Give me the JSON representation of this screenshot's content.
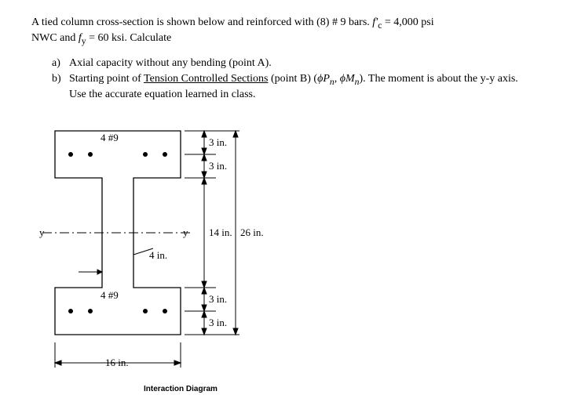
{
  "problem": {
    "line1_prefix": "A tied column cross-section is shown below and reinforced with (8) # 9 bars. ",
    "fc_symbol": "f'",
    "fc_sub": "c",
    "fc_eq": " = 4,000 psi",
    "line2_prefix": "NWC and ",
    "fy_symbol": "f",
    "fy_sub": "y",
    "fy_eq": " = 60 ksi. Calculate"
  },
  "parts": {
    "a": {
      "marker": "a)",
      "text": "Axial capacity without any bending (point A)."
    },
    "b": {
      "marker": "b)",
      "text_before": "Starting point of ",
      "underlined": "Tension Controlled Sections",
      "text_mid": " (point B) (",
      "phi1": "ϕP",
      "phi1_sub": "n",
      "comma": ", ",
      "phi2": "ϕM",
      "phi2_sub": "n",
      "text_after": "). The moment is about the y-y axis. Use the accurate equation learned in class."
    }
  },
  "labels": {
    "top_rebar": "4 #9",
    "bottom_rebar": "4 #9",
    "y_axis": "y",
    "web_width": "4 in.",
    "total_width": "16 in.",
    "dim_3in": "3 in.",
    "dim_14in": "14 in.",
    "dim_26in": "26 in."
  },
  "caption": "Interaction Diagram",
  "chart_data": {
    "type": "diagram",
    "description": "I-shaped tied column cross-section",
    "total_height_in": 26,
    "total_width_in": 16,
    "top_flange_height_in": 6,
    "bottom_flange_height_in": 6,
    "web_height_in": 14,
    "web_width_in": 4,
    "rebar_cover_in": 3,
    "top_rebar_count": 4,
    "bottom_rebar_count": 4,
    "rebar_size": "#9",
    "fc_psi": 4000,
    "fy_ksi": 60,
    "bending_axis": "y-y"
  }
}
